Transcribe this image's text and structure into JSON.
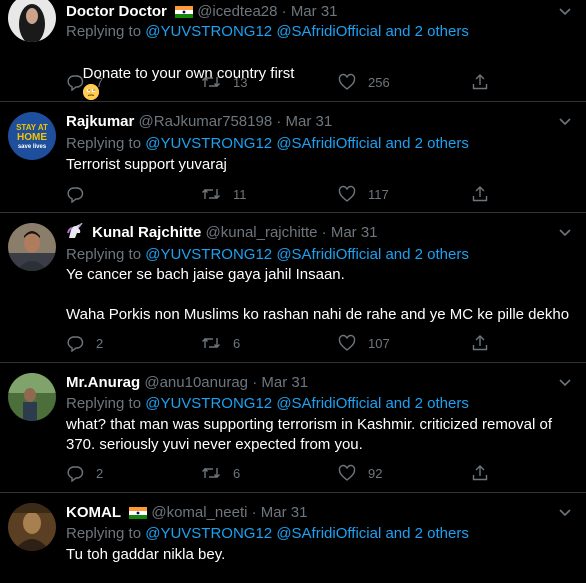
{
  "tweets": [
    {
      "name": "Doctor Doctor",
      "handle": "@icedtea28",
      "dot": "·",
      "date": "Mar 31",
      "replying_prefix": "Replying to",
      "mention1": "@YUVSTRONG12",
      "mention2": "@SAfridiOfficial",
      "replying_suffix": "and 2 others",
      "text": "Donate to your own country first",
      "replies": "7",
      "retweets": "13",
      "likes": "256"
    },
    {
      "name": "Rajkumar",
      "handle": "@RaJkumar758198",
      "dot": "·",
      "date": "Mar 31",
      "replying_prefix": "Replying to",
      "mention1": "@YUVSTRONG12",
      "mention2": "@SAfridiOfficial",
      "replying_suffix": "and 2 others",
      "text": "Terrorist support yuvaraj",
      "replies": "",
      "retweets": "11",
      "likes": "117",
      "avatar_text1": "STAY AT",
      "avatar_text2": "HOME",
      "avatar_text3": "save lives"
    },
    {
      "name": "Kunal Rajchitte",
      "handle": "@kunal_rajchitte",
      "dot": "·",
      "date": "Mar 31",
      "replying_prefix": "Replying to",
      "mention1": "@YUVSTRONG12",
      "mention2": "@SAfridiOfficial",
      "replying_suffix": "and 2 others",
      "text": "Ye cancer se bach jaise gaya jahil Insaan.\n\nWaha Porkis non Muslims ko rashan nahi de rahe and ye MC ke pille dekho",
      "replies": "2",
      "retweets": "6",
      "likes": "107"
    },
    {
      "name": "Mr.Anurag",
      "handle": "@anu10anurag",
      "dot": "·",
      "date": "Mar 31",
      "replying_prefix": "Replying to",
      "mention1": "@YUVSTRONG12",
      "mention2": "@SAfridiOfficial",
      "replying_suffix": "and 2 others",
      "text": "what? that man was supporting terrorism in Kashmir. criticized removal of 370. seriously yuvi never expected from you.",
      "replies": "2",
      "retweets": "6",
      "likes": "92"
    },
    {
      "name": "KOMAL",
      "handle": "@komal_neeti",
      "dot": "·",
      "date": "Mar 31",
      "replying_prefix": "Replying to",
      "mention1": "@YUVSTRONG12",
      "mention2": "@SAfridiOfficial",
      "replying_suffix": "and 2 others",
      "text": "Tu toh gaddar nikla bey."
    }
  ],
  "colors": {
    "background": "#000000",
    "text": "#ffffff",
    "secondary": "#6e767d",
    "link": "#1da1f2",
    "divider": "#2f3336"
  },
  "icons": [
    "reply-icon",
    "retweet-icon",
    "like-icon",
    "share-icon",
    "chevron-down-icon",
    "india-flag-icon",
    "unicorn-icon",
    "face-emoji-icon"
  ]
}
